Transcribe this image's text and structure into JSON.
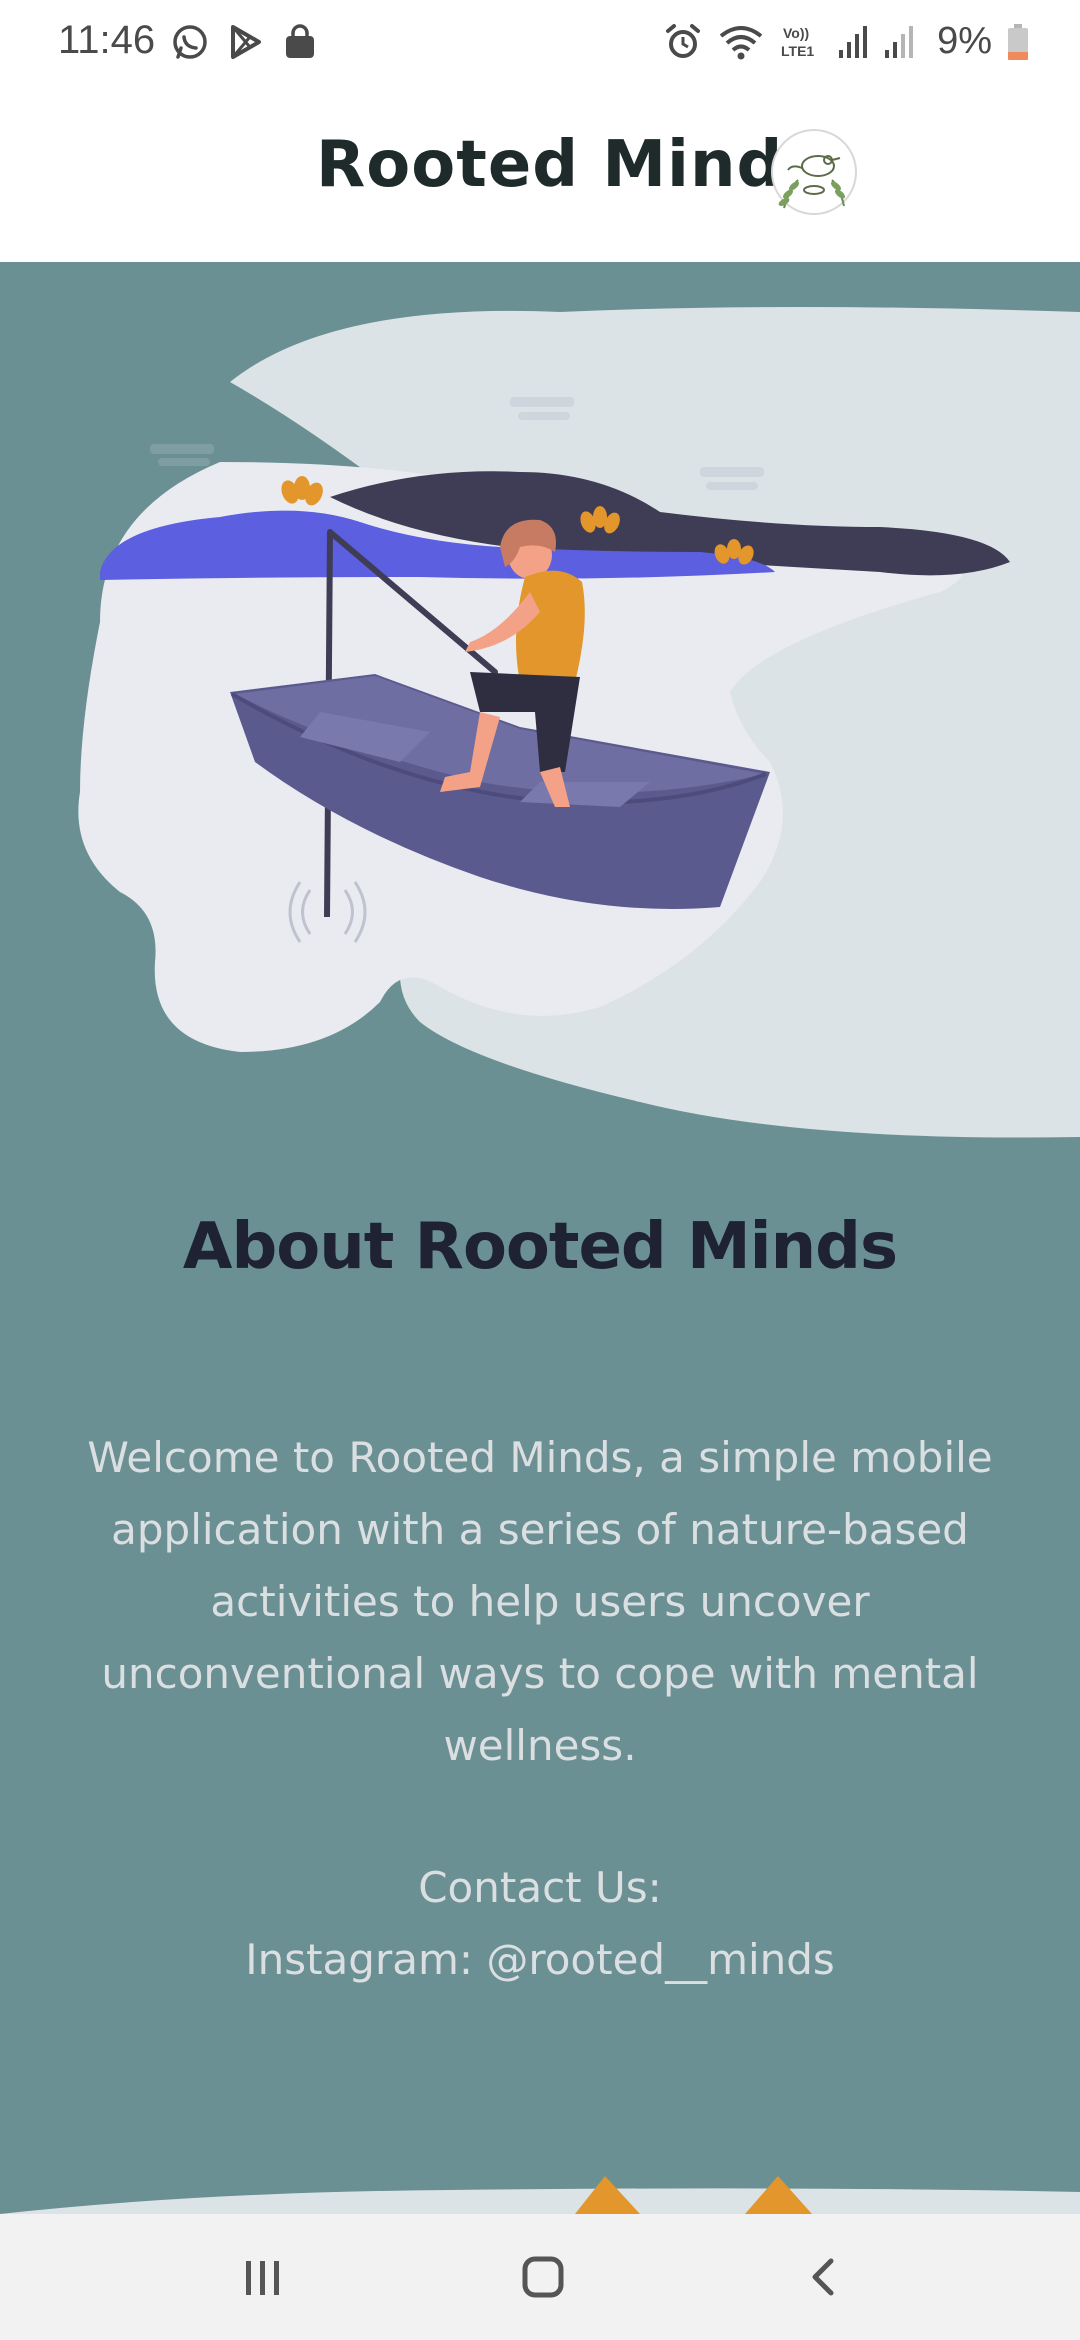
{
  "status_bar": {
    "time": "11:46",
    "battery_percent": "9%",
    "left_icons": [
      "whatsapp-icon",
      "play-store-icon",
      "shopping-bag-icon"
    ],
    "right_icons": [
      "alarm-icon",
      "wifi-icon",
      "volte-lte-icon",
      "signal-icon",
      "signal-weak-icon",
      "battery-low-icon"
    ]
  },
  "header": {
    "title": "Rooted Minds",
    "logo_icon": "bird-leaf-logo-icon"
  },
  "main": {
    "hero_illustration": "person-fishing-in-boat-illustration",
    "heading": "About Rooted Minds",
    "description": "Welcome to Rooted Minds, a simple mobile application with a series of nature-based activities to help users uncover unconventional ways to cope with mental wellness.",
    "contact_label": "Contact Us:",
    "contact_instagram": "Instagram: @rooted__minds"
  },
  "nav_bar": {
    "recents_icon": "recent-apps-icon",
    "home_icon": "home-icon",
    "back_icon": "back-icon"
  },
  "colors": {
    "main_background": "#6a9093",
    "heading_color": "#1e2233",
    "body_text_color": "#dcdfe2",
    "header_background": "#ffffff",
    "nav_background": "#f2f2f2",
    "accent_orange": "#e2962b",
    "boat_purple": "#5b5a8f",
    "water_blue": "#5b5fe0"
  }
}
